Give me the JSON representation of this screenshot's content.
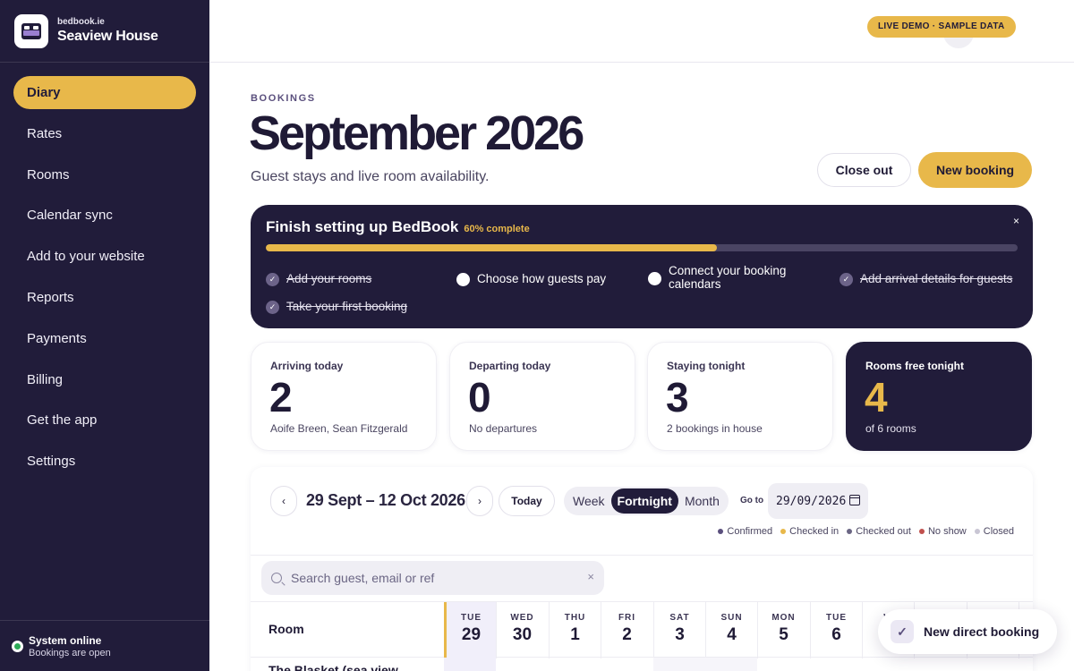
{
  "brand": {
    "domain": "bedbook.ie",
    "property": "Seaview House",
    "logo_icon": "bed-icon"
  },
  "nav": [
    {
      "label": "Diary",
      "active": true
    },
    {
      "label": "Rates"
    },
    {
      "label": "Rooms"
    },
    {
      "label": "Calendar sync"
    },
    {
      "label": "Add to your website"
    },
    {
      "label": "Reports"
    },
    {
      "label": "Payments"
    },
    {
      "label": "Billing"
    },
    {
      "label": "Get the app"
    },
    {
      "label": "Settings"
    }
  ],
  "system": {
    "title": "System online",
    "subtitle": "Bookings are open",
    "status_color": "#2dab58"
  },
  "topbar": {
    "badge": "LIVE DEMO · SAMPLE DATA"
  },
  "header": {
    "eyebrow": "BOOKINGS",
    "title": "September 2026",
    "subtitle": "Guest stays and live room availability.",
    "close_out": "Close out",
    "new_booking": "New booking"
  },
  "setup": {
    "title": "Finish setting up BedBook",
    "percent_label": "60% complete",
    "progress": 0.6,
    "close": "×",
    "tasks": [
      {
        "label": "Add your rooms",
        "done": true
      },
      {
        "label": "Choose how guests pay",
        "done": false
      },
      {
        "label": "Connect your booking calendars",
        "done": false
      },
      {
        "label": "Add arrival details for guests",
        "done": true
      },
      {
        "label": "Take your first booking",
        "done": true
      }
    ]
  },
  "stats": [
    {
      "label": "Arriving today",
      "value": "2",
      "sub": "Aoife Breen, Sean Fitzgerald"
    },
    {
      "label": "Departing today",
      "value": "0",
      "sub": "No departures"
    },
    {
      "label": "Staying tonight",
      "value": "3",
      "sub": "2 bookings in house"
    },
    {
      "label": "Rooms free tonight",
      "value": "4",
      "sub": "of 6 rooms"
    }
  ],
  "diary": {
    "prev": "‹",
    "next": "›",
    "range": "29 Sept – 12 Oct 2026",
    "today": "Today",
    "views": [
      "Week",
      "Fortnight",
      "Month"
    ],
    "active_view": "Fortnight",
    "goto_label": "Go to",
    "goto_value": "29/09/2026",
    "legend": [
      {
        "label": "Confirmed",
        "color": "#5a4f7d"
      },
      {
        "label": "Checked in",
        "color": "#e8b84a"
      },
      {
        "label": "Checked out",
        "color": "#6b6684"
      },
      {
        "label": "No show",
        "color": "#c0504d"
      },
      {
        "label": "Closed",
        "color": "#c9c6d4"
      }
    ],
    "search_placeholder": "Search guest, email or ref",
    "search_clear": "×",
    "room_header": "Room",
    "days": [
      {
        "dow": "TUE",
        "num": "29",
        "today": true
      },
      {
        "dow": "WED",
        "num": "30"
      },
      {
        "dow": "THU",
        "num": "1"
      },
      {
        "dow": "FRI",
        "num": "2"
      },
      {
        "dow": "SAT",
        "num": "3"
      },
      {
        "dow": "SUN",
        "num": "4"
      },
      {
        "dow": "MON",
        "num": "5"
      },
      {
        "dow": "TUE",
        "num": "6"
      },
      {
        "dow": "W",
        "num": ""
      }
    ],
    "first_room": "The Blasket (sea view"
  },
  "toast": {
    "label": "New direct booking",
    "icon": "check-icon"
  }
}
